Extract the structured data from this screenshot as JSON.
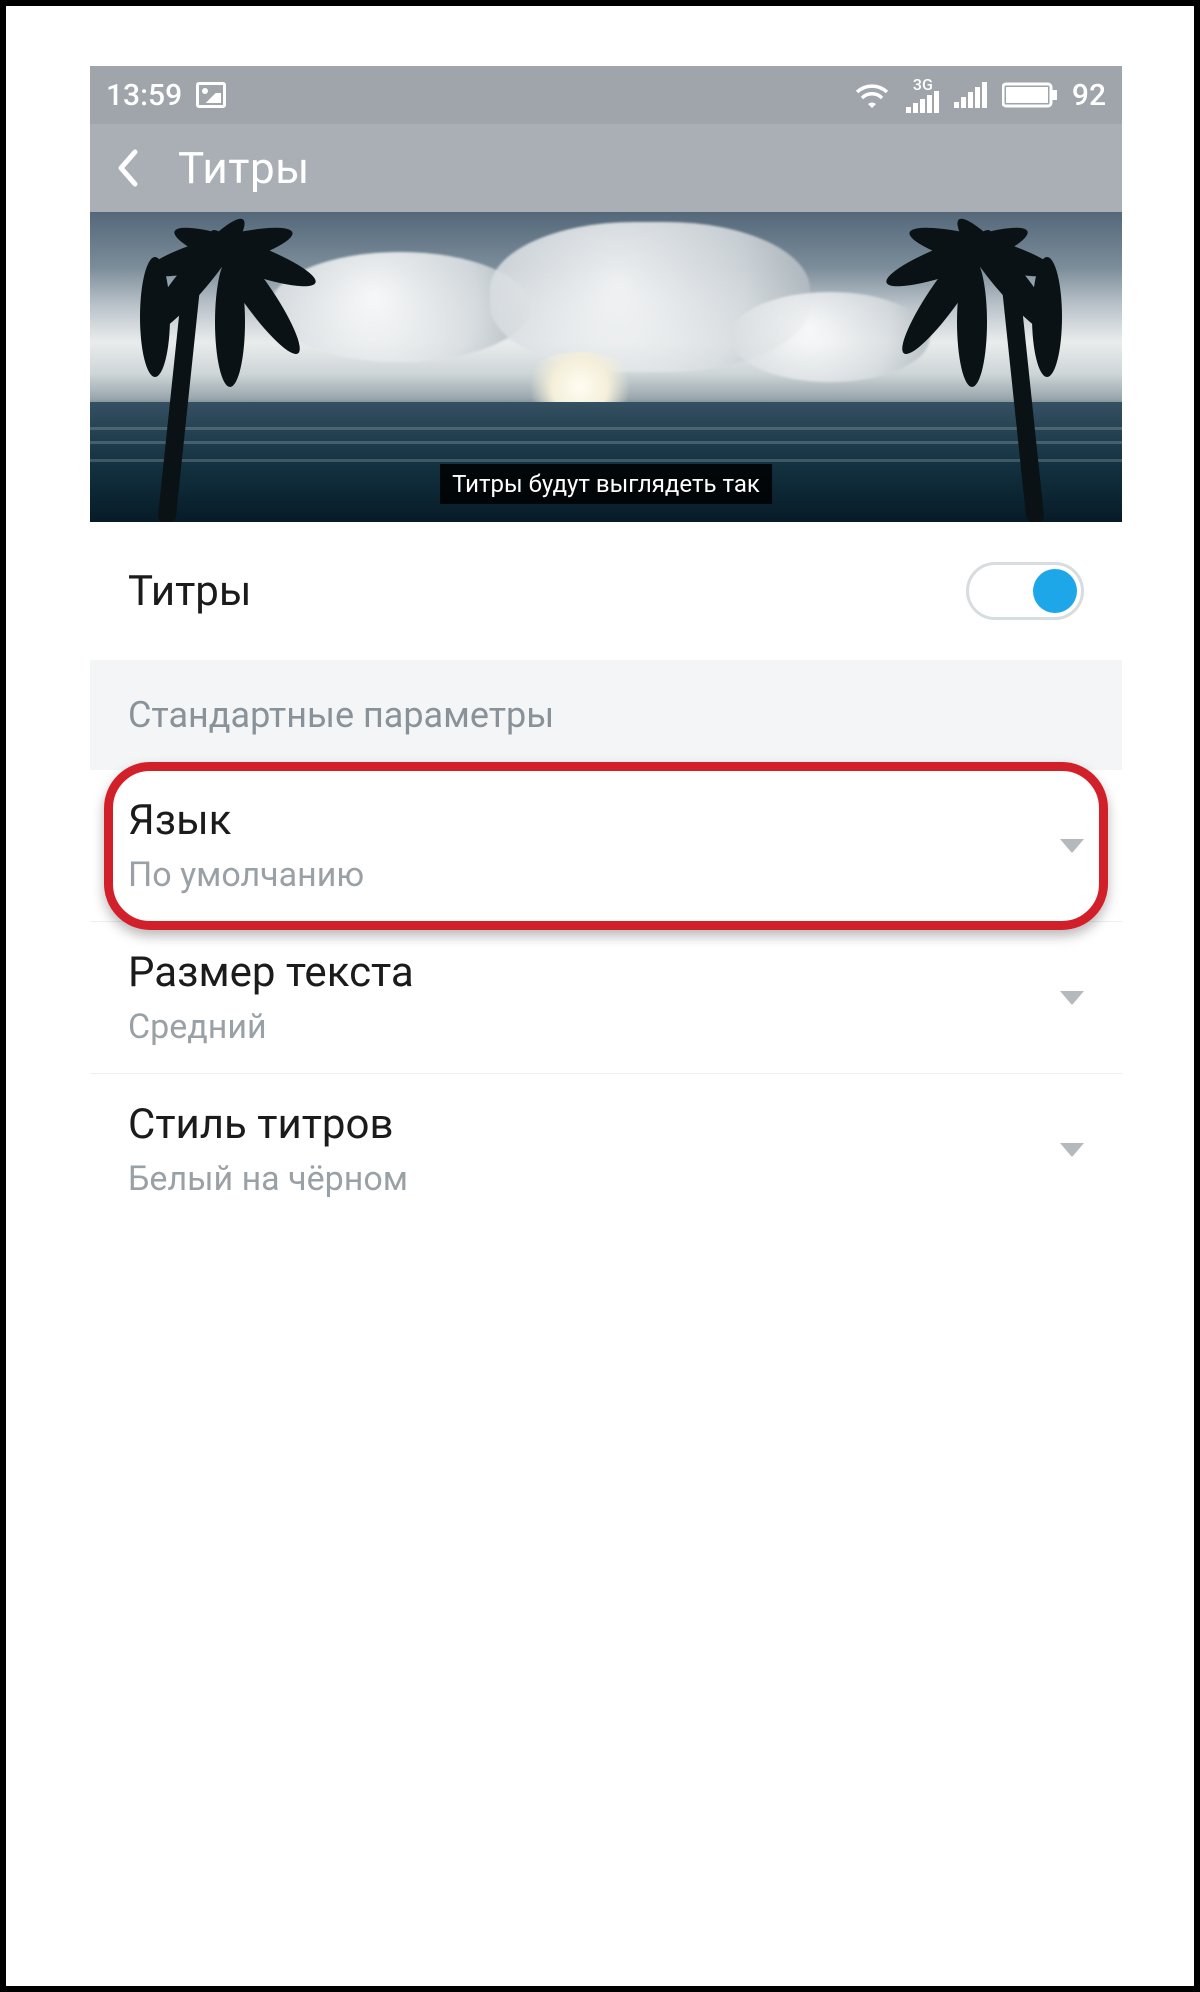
{
  "status": {
    "time": "13:59",
    "network_label": "3G",
    "battery_text": "92"
  },
  "header": {
    "title": "Титры"
  },
  "preview": {
    "caption_text": "Титры будут выглядеть так"
  },
  "settings": {
    "captions_toggle": {
      "label": "Титры",
      "enabled": true
    },
    "section_label": "Стандартные параметры",
    "items": [
      {
        "title": "Язык",
        "value": "По умолчанию"
      },
      {
        "title": "Размер текста",
        "value": "Средний"
      },
      {
        "title": "Стиль титров",
        "value": "Белый на чёрном"
      }
    ]
  },
  "colors": {
    "accent": "#1ea7e8",
    "highlight": "#d1202a"
  }
}
